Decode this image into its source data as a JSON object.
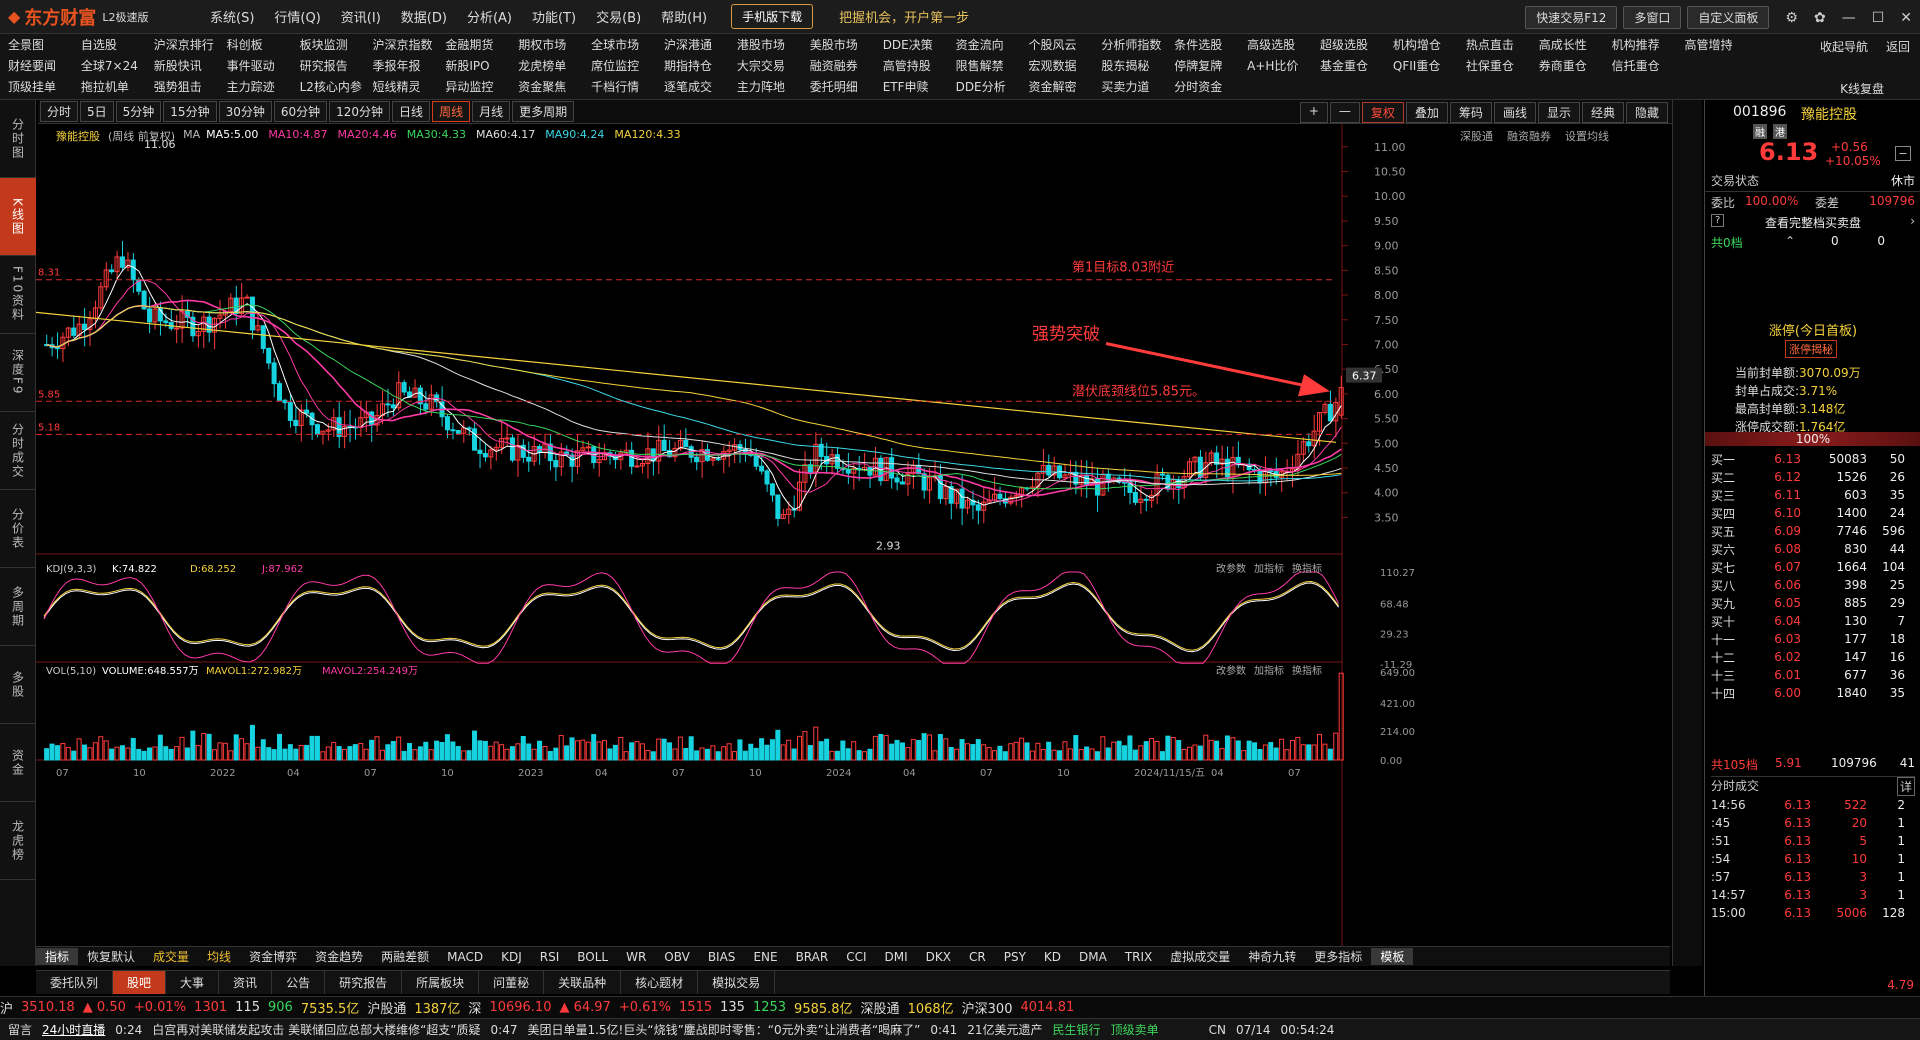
{
  "app": {
    "logo": "东方财富",
    "badge": "L2极速版",
    "menu": [
      "系统(S)",
      "行情(Q)",
      "资讯(I)",
      "数据(D)",
      "分析(A)",
      "功能(T)",
      "交易(B)",
      "帮助(H)"
    ],
    "mobile_btn": "手机版下载",
    "promo": "把握机会，开户第一步",
    "right_btns": [
      "快速交易F12",
      "多窗口",
      "自定义面板"
    ]
  },
  "quicknav": {
    "row1": [
      "全景图",
      "自选股",
      "沪深京排行",
      "科创板",
      "板块监测",
      "沪深京指数",
      "金融期货",
      "期权市场",
      "全球市场",
      "沪深港通",
      "港股市场",
      "美股市场",
      "DDE决策",
      "资金流向",
      "个股风云",
      "分析师指数",
      "条件选股",
      "高级选股",
      "超级选股",
      "机构增仓",
      "热点直击",
      "高成长性",
      "机构推荐",
      "高管增持"
    ],
    "row2": [
      "财经要闻",
      "全球7×24",
      "新股快讯",
      "事件驱动",
      "研究报告",
      "季报年报",
      "新股IPO",
      "龙虎榜单",
      "席位监控",
      "期指持仓",
      "大宗交易",
      "融资融券",
      "高管持股",
      "限售解禁",
      "宏观数据",
      "股东揭秘",
      "停牌复牌",
      "A+H比价",
      "基金重仓",
      "QFII重仓",
      "社保重仓",
      "券商重仓",
      "信托重仓"
    ],
    "row3": [
      "顶级挂单",
      "拖拉机单",
      "强势狙击",
      "主力踪迹",
      "L2核心内参",
      "短线精灵",
      "异动监控",
      "资金聚焦",
      "千档行情",
      "逐笔成交",
      "主力阵地",
      "委托明细",
      "ETF申赎",
      "DDE分析",
      "资金解密",
      "买卖力道",
      "分时资金"
    ],
    "side": [
      "收起导航",
      "返回"
    ],
    "side2": [
      "K线复盘"
    ]
  },
  "leftbar": [
    "分时图",
    "K线图",
    "F10资料",
    "深度F9",
    "分时成交",
    "分价表",
    "多周期",
    "多股",
    "资金",
    "龙虎榜"
  ],
  "periods": [
    "分时",
    "5日",
    "5分钟",
    "15分钟",
    "30分钟",
    "60分钟",
    "120分钟",
    "日线",
    "周线",
    "月线",
    "更多周期"
  ],
  "period_right": [
    "+",
    "—",
    "复权",
    "叠加",
    "筹码",
    "画线",
    "显示",
    "经典",
    "隐藏"
  ],
  "main_header": {
    "name": "豫能控股",
    "mode": "(周线 前复权)",
    "ma_label": "MA",
    "ma": [
      {
        "t": "MA5:5.00",
        "c": "#ffffff"
      },
      {
        "t": "MA10:4.87",
        "c": "#ff3ba6"
      },
      {
        "t": "MA20:4.46",
        "c": "#ff3ba6"
      },
      {
        "t": "MA30:4.33",
        "c": "#3bd65c"
      },
      {
        "t": "MA60:4.17",
        "c": "#e0e0e0"
      },
      {
        "t": "MA90:4.24",
        "c": "#3cd9e8"
      },
      {
        "t": "MA120:4.33",
        "c": "#f5d23c"
      }
    ],
    "right": [
      "深股通",
      "融资融券",
      "设置均线"
    ]
  },
  "chart_data": {
    "type": "candlestick",
    "ylim": [
      2.8,
      11.3
    ],
    "yticks": [
      "11.00",
      "10.50",
      "10.00",
      "9.50",
      "9.00",
      "8.50",
      "8.00",
      "7.50",
      "7.00",
      "6.50",
      "6.00",
      "5.50",
      "5.00",
      "4.50",
      "4.00",
      "3.50"
    ],
    "current_price": "6.37",
    "xticks": [
      "07",
      "10",
      "2022",
      "04",
      "07",
      "10",
      "2023",
      "04",
      "07",
      "10",
      "2024",
      "04",
      "07",
      "10",
      "2024/11/15/五",
      "04",
      "07"
    ],
    "annotations": {
      "high": "11.06",
      "low": "2.93",
      "target": "第1目标8.03附近",
      "support": "潜伏底颈线位5.85元。",
      "breakout": "强势突破",
      "lvl_left_top": "8.31",
      "lvl_left_mid": "5.85",
      "lvl_left_low": "5.18"
    },
    "kdj": {
      "label": "KDJ(9,3,3)",
      "k": "K:74.822",
      "d": "D:68.252",
      "j": "J:87.962",
      "yticks": [
        "110.27",
        "68.48",
        "29.23",
        "-11.29"
      ]
    },
    "vol": {
      "label": "VOL(5,10)",
      "v": "VOLUME:648.557万",
      "m1": "MAVOL1:272.982万",
      "m2": "MAVOL2:254.249万",
      "yticks": [
        "649.00",
        "421.00",
        "214.00",
        "0.00"
      ]
    },
    "subpanel_btns": [
      "改参数",
      "加指标",
      "换指标"
    ]
  },
  "indicator_tabs": [
    "指标",
    "恢复默认",
    "成交量",
    "均线",
    "资金博弈",
    "资金趋势",
    "两融差额",
    "MACD",
    "KDJ",
    "RSI",
    "BOLL",
    "WR",
    "OBV",
    "BIAS",
    "ENE",
    "BRAR",
    "CCI",
    "DMI",
    "DKX",
    "CR",
    "PSY",
    "KD",
    "DMA",
    "TRIX",
    "虚拟成交量",
    "神奇九转",
    "更多指标",
    "模板"
  ],
  "bottom_tabs": [
    "委托队列",
    "股吧",
    "大事",
    "资讯",
    "公告",
    "研究报告",
    "所属板块",
    "问董秘",
    "关联品种",
    "核心题材",
    "模拟交易"
  ],
  "indexbar": [
    {
      "t": "沪",
      "c": "#ddd"
    },
    {
      "t": "3510.18",
      "c": "#ff3b3b"
    },
    {
      "t": "▲ 0.50",
      "c": "#ff3b3b"
    },
    {
      "t": "+0.01%",
      "c": "#ff3b3b"
    },
    {
      "t": "1301",
      "c": "#ff3b3b"
    },
    {
      "t": "115",
      "c": "#ddd"
    },
    {
      "t": "906",
      "c": "#3bd65c"
    },
    {
      "t": "7535.5亿",
      "c": "#f5d23c"
    },
    {
      "t": "沪股通",
      "c": "#ddd"
    },
    {
      "t": "1387亿",
      "c": "#f5d23c"
    },
    {
      "t": "深",
      "c": "#ddd"
    },
    {
      "t": "10696.10",
      "c": "#ff3b3b"
    },
    {
      "t": "▲ 64.97",
      "c": "#ff3b3b"
    },
    {
      "t": "+0.61%",
      "c": "#ff3b3b"
    },
    {
      "t": "1515",
      "c": "#ff3b3b"
    },
    {
      "t": "135",
      "c": "#ddd"
    },
    {
      "t": "1253",
      "c": "#3bd65c"
    },
    {
      "t": "9585.8亿",
      "c": "#f5d23c"
    },
    {
      "t": "深股通",
      "c": "#ddd"
    },
    {
      "t": "1068亿",
      "c": "#f5d23c"
    },
    {
      "t": "沪深300",
      "c": "#ddd"
    },
    {
      "t": "4014.81",
      "c": "#ff3b3b"
    }
  ],
  "newsbar": {
    "left": "留言",
    "live": "24小时直播",
    "time1": "0:24",
    "n1": "白宫再对美联储发起攻击 美联储回应总部大楼维修“超支”质疑",
    "time2": "0:47",
    "n2": "美团日单量1.5亿!巨头“烧钱”鏖战即时零售：“0元外卖”让消费者“喝麻了”",
    "time3": "0:41",
    "n3": "21亿美元遗产",
    "stock": "民生银行",
    "stock_tag": "顶级卖单",
    "lang": "CN",
    "date": "07/14",
    "clock": "00:54:24"
  },
  "right_panel": {
    "code": "001896",
    "name": "豫能控股",
    "tags": [
      "融",
      "港"
    ],
    "price": "6.13",
    "chg": "+0.56",
    "pct": "+10.05%",
    "status_label": "交易状态",
    "status": "休市",
    "wb_label": "委比",
    "wb": "100.00%",
    "wc_label": "委差",
    "wc": "109796",
    "full_book": "查看完整档买卖盘",
    "sell_total_label": "共0档",
    "sell_total_a": "0",
    "sell_total_b": "0",
    "limit_title": "涨停(今日首板)",
    "limit_tag": "涨停揭秘",
    "limit_rows": [
      {
        "k": "当前封单额:",
        "v": "3070.09万"
      },
      {
        "k": "封单占成交:",
        "v": "3.71%"
      },
      {
        "k": "最高封单额:",
        "v": "3.148亿"
      },
      {
        "k": "涨停成交额:",
        "v": "1.764亿"
      }
    ],
    "pct_label": "100%",
    "bids": [
      {
        "l": "买一",
        "p": "6.13",
        "v": "50083",
        "n": "50"
      },
      {
        "l": "买二",
        "p": "6.12",
        "v": "1526",
        "n": "26"
      },
      {
        "l": "买三",
        "p": "6.11",
        "v": "603",
        "n": "35"
      },
      {
        "l": "买四",
        "p": "6.10",
        "v": "1400",
        "n": "24"
      },
      {
        "l": "买五",
        "p": "6.09",
        "v": "7746",
        "n": "596"
      },
      {
        "l": "买六",
        "p": "6.08",
        "v": "830",
        "n": "44"
      },
      {
        "l": "买七",
        "p": "6.07",
        "v": "1664",
        "n": "104"
      },
      {
        "l": "买八",
        "p": "6.06",
        "v": "398",
        "n": "25"
      },
      {
        "l": "买九",
        "p": "6.05",
        "v": "885",
        "n": "29"
      },
      {
        "l": "买十",
        "p": "6.04",
        "v": "130",
        "n": "7"
      },
      {
        "l": "十一",
        "p": "6.03",
        "v": "177",
        "n": "18"
      },
      {
        "l": "十二",
        "p": "6.02",
        "v": "147",
        "n": "16"
      },
      {
        "l": "十三",
        "p": "6.01",
        "v": "677",
        "n": "36"
      },
      {
        "l": "十四",
        "p": "6.00",
        "v": "1840",
        "n": "35"
      }
    ],
    "buy_total_label": "共105档",
    "buy_total_p": "5.91",
    "buy_total_v": "109796",
    "buy_total_n": "41",
    "ticks_label": "分时成交",
    "ticks_btn": "详",
    "ticks": [
      {
        "t": "14:56",
        "p": "6.13",
        "v": "522",
        "n": "2"
      },
      {
        "t": ":45",
        "p": "6.13",
        "v": "20",
        "n": "1"
      },
      {
        "t": ":51",
        "p": "6.13",
        "v": "5",
        "n": "1"
      },
      {
        "t": ":54",
        "p": "6.13",
        "v": "10",
        "n": "1"
      },
      {
        "t": ":57",
        "p": "6.13",
        "v": "3",
        "n": "1"
      },
      {
        "t": "14:57",
        "p": "6.13",
        "v": "3",
        "n": "1"
      },
      {
        "t": "15:00",
        "p": "6.13",
        "v": "5006",
        "n": "128"
      }
    ],
    "last_price": "4.79"
  },
  "colors": {
    "up": "#ff3b3b",
    "down": "#17d3e0",
    "accent": "#c23a1b"
  }
}
